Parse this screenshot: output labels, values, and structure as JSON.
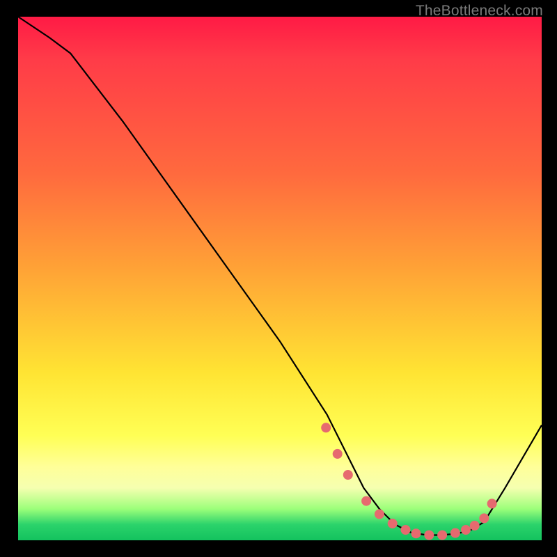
{
  "watermark": "TheBottleneck.com",
  "chart_data": {
    "type": "line",
    "title": "",
    "xlabel": "",
    "ylabel": "",
    "xlim": [
      0,
      100
    ],
    "ylim": [
      0,
      100
    ],
    "series": [
      {
        "name": "curve",
        "x": [
          0,
          6,
          10,
          20,
          30,
          40,
          50,
          59,
          63,
          66,
          69,
          72,
          75,
          78,
          81,
          84,
          86.5,
          89,
          93,
          100
        ],
        "y": [
          100,
          96,
          93,
          80,
          66,
          52,
          38,
          24,
          16,
          10,
          6,
          3,
          1.5,
          1,
          1,
          1.3,
          2,
          3.5,
          10,
          22
        ]
      }
    ],
    "markers": {
      "name": "dots",
      "color": "#e66a6f",
      "x": [
        58.8,
        61,
        63,
        66.5,
        69,
        71.5,
        74,
        76,
        78.5,
        81,
        83.5,
        85.5,
        87.2,
        89,
        90.5
      ],
      "y": [
        21.5,
        16.5,
        12.5,
        7.5,
        5,
        3.2,
        2,
        1.3,
        1,
        1,
        1.4,
        2,
        2.8,
        4.2,
        7
      ]
    },
    "gradient_stops": [
      {
        "pos": 0,
        "color": "#ff1a45"
      },
      {
        "pos": 30,
        "color": "#ff6a3e"
      },
      {
        "pos": 68,
        "color": "#ffe433"
      },
      {
        "pos": 86,
        "color": "#ffff99"
      },
      {
        "pos": 97,
        "color": "#2bd36b"
      }
    ]
  }
}
